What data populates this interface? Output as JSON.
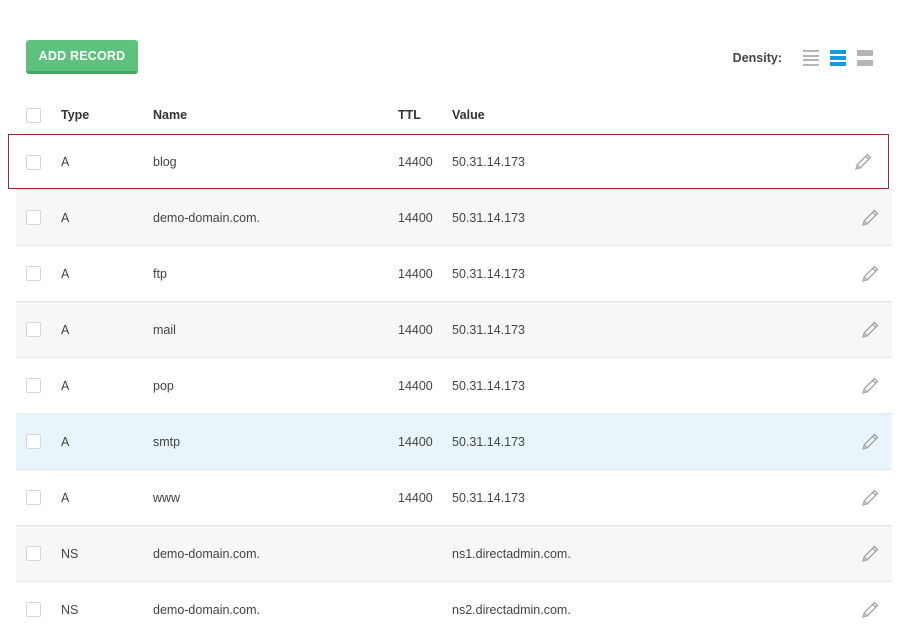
{
  "toolbar": {
    "add_label": "ADD RECORD",
    "density_label": "Density:"
  },
  "columns": {
    "type": "Type",
    "name": "Name",
    "ttl": "TTL",
    "value": "Value"
  },
  "records": [
    {
      "type": "A",
      "name": "blog",
      "ttl": "14400",
      "value": "50.31.14.173"
    },
    {
      "type": "A",
      "name": "demo-domain.com.",
      "ttl": "14400",
      "value": "50.31.14.173"
    },
    {
      "type": "A",
      "name": "ftp",
      "ttl": "14400",
      "value": "50.31.14.173"
    },
    {
      "type": "A",
      "name": "mail",
      "ttl": "14400",
      "value": "50.31.14.173"
    },
    {
      "type": "A",
      "name": "pop",
      "ttl": "14400",
      "value": "50.31.14.173"
    },
    {
      "type": "A",
      "name": "smtp",
      "ttl": "14400",
      "value": "50.31.14.173"
    },
    {
      "type": "A",
      "name": "www",
      "ttl": "14400",
      "value": "50.31.14.173"
    },
    {
      "type": "NS",
      "name": "demo-domain.com.",
      "ttl": "",
      "value": "ns1.directadmin.com."
    },
    {
      "type": "NS",
      "name": "demo-domain.com.",
      "ttl": "",
      "value": "ns2.directadmin.com."
    }
  ],
  "icons": {
    "edit": "pencil-icon"
  },
  "colors": {
    "accent": "#5cc27d",
    "density_active": "#1a9bd7",
    "hover_row": "#e8f5fb",
    "selected_outline": "#a3262a"
  }
}
